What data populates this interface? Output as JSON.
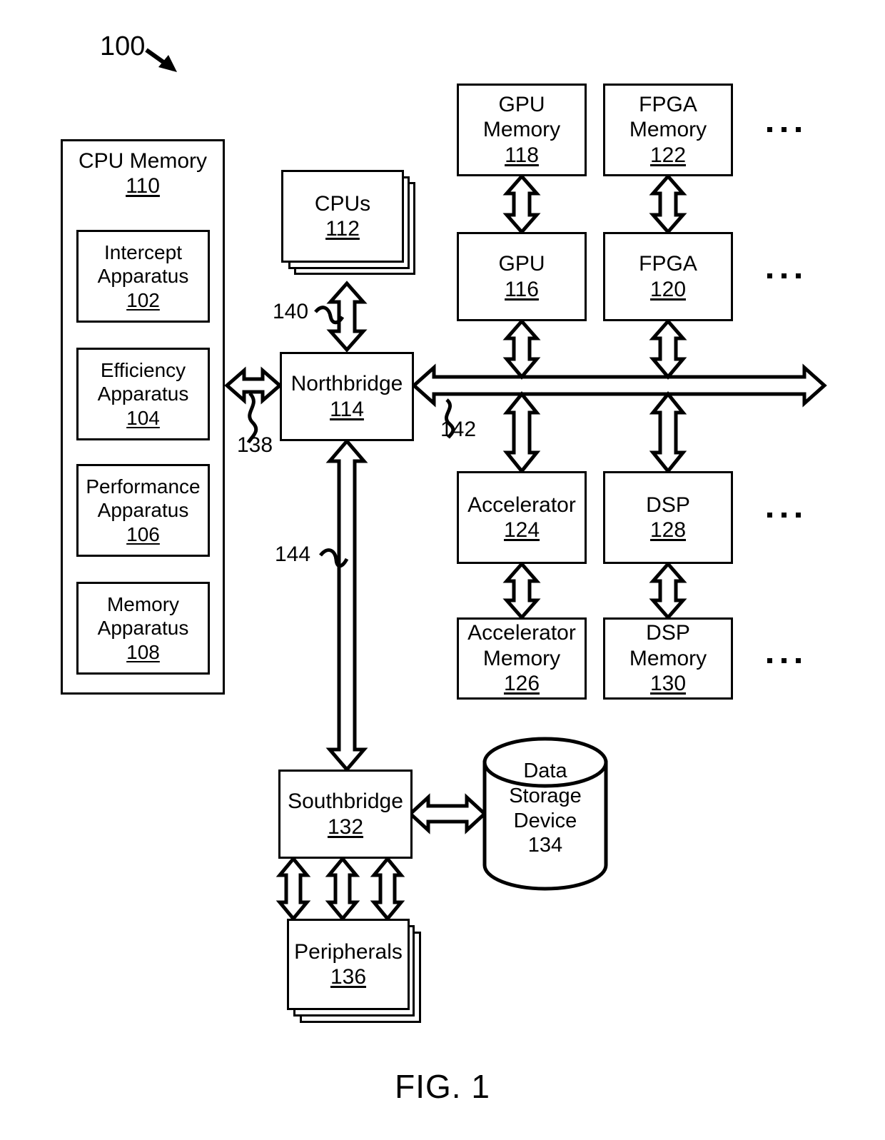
{
  "figure": {
    "caption": "FIG. 1",
    "system_ref": "100"
  },
  "cpu_memory": {
    "title": "CPU Memory",
    "ref": "110",
    "components": [
      {
        "title_line1": "Intercept",
        "title_line2": "Apparatus",
        "ref": "102"
      },
      {
        "title_line1": "Efficiency",
        "title_line2": "Apparatus",
        "ref": "104"
      },
      {
        "title_line1": "Performance",
        "title_line2": "Apparatus",
        "ref": "106"
      },
      {
        "title_line1": "Memory",
        "title_line2": "Apparatus",
        "ref": "108"
      }
    ]
  },
  "cpus": {
    "title": "CPUs",
    "ref": "112"
  },
  "northbridge": {
    "title": "Northbridge",
    "ref": "114"
  },
  "southbridge": {
    "title": "Southbridge",
    "ref": "132"
  },
  "peripherals": {
    "title": "Peripherals",
    "ref": "136"
  },
  "data_storage": {
    "title_line1": "Data",
    "title_line2": "Storage",
    "title_line3": "Device",
    "ref": "134"
  },
  "accelerator_columns": [
    {
      "memory_top": {
        "title_line1": "GPU",
        "title_line2": "Memory",
        "ref": "118"
      },
      "device": {
        "title": "GPU",
        "ref": "116"
      },
      "device_lower": {
        "title": "Accelerator",
        "ref": "124"
      },
      "memory_bottom": {
        "title_line1": "Accelerator",
        "title_line2": "Memory",
        "ref": "126"
      }
    },
    {
      "memory_top": {
        "title_line1": "FPGA",
        "title_line2": "Memory",
        "ref": "122"
      },
      "device": {
        "title": "FPGA",
        "ref": "120"
      },
      "device_lower": {
        "title": "DSP",
        "ref": "128"
      },
      "memory_bottom": {
        "title_line1": "DSP",
        "title_line2": "Memory",
        "ref": "130"
      }
    }
  ],
  "connection_labels": {
    "cpu_memory_bus": "138",
    "cpu_bus": "140",
    "accelerator_bus": "142",
    "southbridge_bus": "144"
  },
  "colors": {
    "stroke": "#000000",
    "fill": "#ffffff"
  }
}
